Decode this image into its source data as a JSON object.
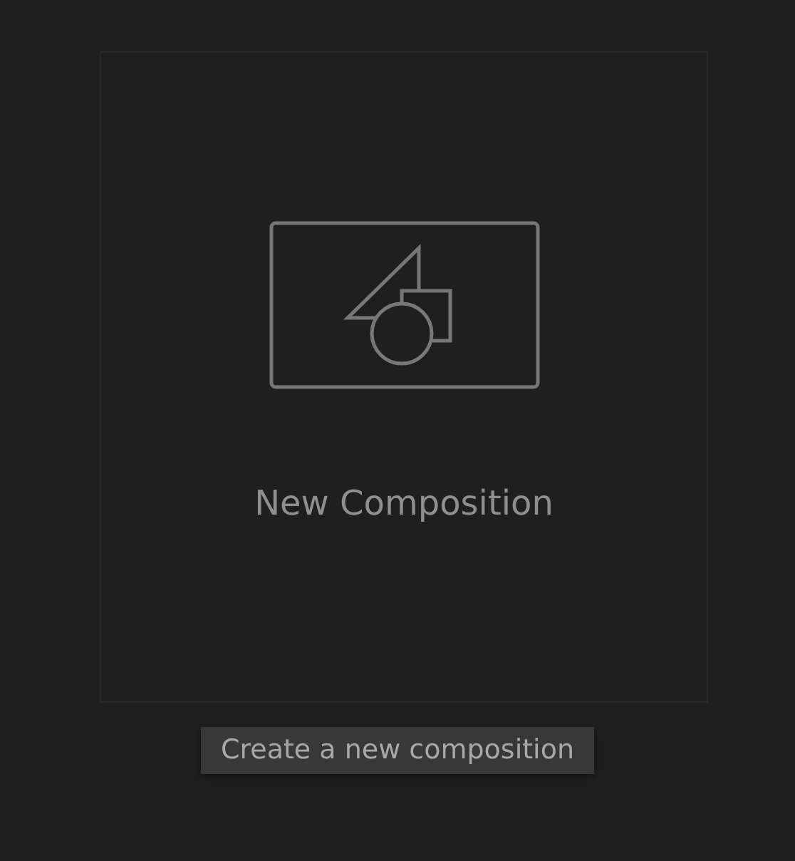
{
  "card": {
    "title": "New Composition"
  },
  "tooltip": {
    "text": "Create a new composition"
  }
}
